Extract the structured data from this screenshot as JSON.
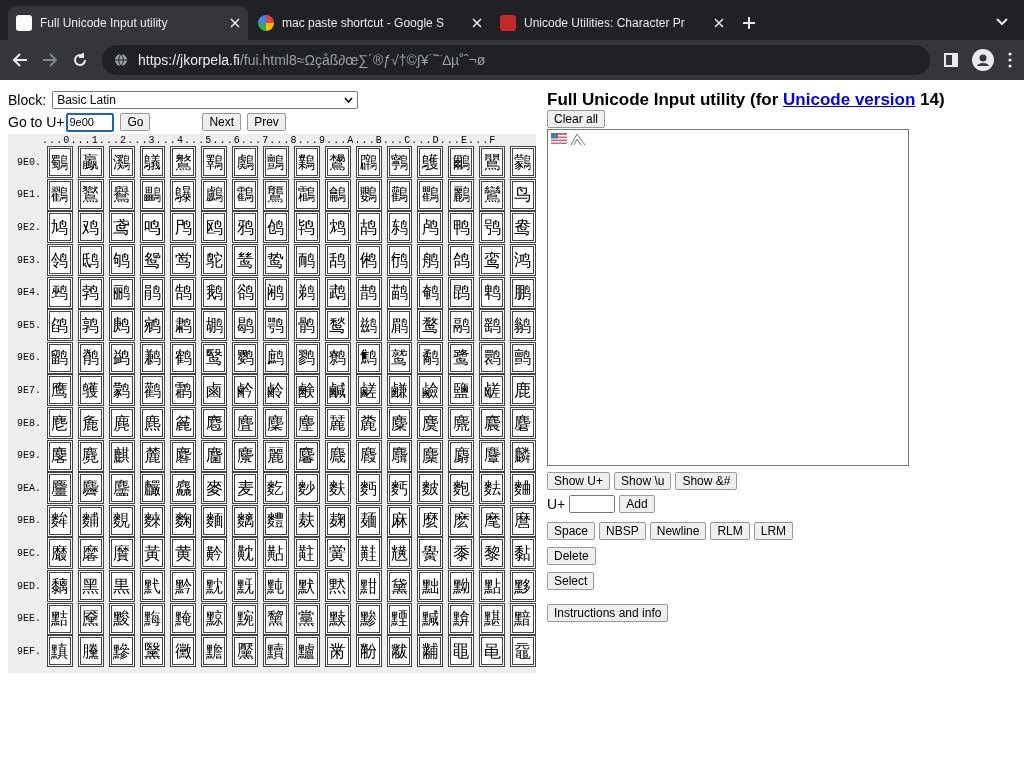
{
  "tabs": [
    {
      "title": "Full Unicode Input utility",
      "selected": true
    },
    {
      "title": "mac paste shortcut - Google S",
      "selected": false
    },
    {
      "title": "Unicode Utilities: Character Pr",
      "selected": false
    }
  ],
  "address": {
    "host": "https://jkorpela.fi",
    "path": "/fui.html8≈Ωçåß∂œ∑´®ƒ√†©∫¥˙˜¨∆µ˚ˆ¬ø"
  },
  "block": {
    "label": "Block:",
    "value": "Basic Latin"
  },
  "goto": {
    "label": "Go to U+",
    "value": "9e00",
    "buttons": [
      "Go",
      "Next",
      "Prev"
    ]
  },
  "grid": {
    "header": "...0...1...2...3...4...5...6...7...8...9...A...B...C...D...E...F",
    "rows": [
      {
        "label": "9E0.",
        "cells": [
          "鸀",
          "鸁",
          "鸂",
          "鸃",
          "鸄",
          "鸅",
          "鸆",
          "鸇",
          "鸈",
          "鸉",
          "鸊",
          "鸋",
          "鸌",
          "鸍",
          "鸎",
          "鸏"
        ]
      },
      {
        "label": "9E1.",
        "cells": [
          "鸐",
          "鸑",
          "鸒",
          "鸓",
          "鸔",
          "鸕",
          "鸖",
          "鸗",
          "鸘",
          "鸙",
          "鸚",
          "鸛",
          "鸜",
          "鸝",
          "鸞",
          "鸟"
        ]
      },
      {
        "label": "9E2.",
        "cells": [
          "鸠",
          "鸡",
          "鸢",
          "鸣",
          "鸤",
          "鸥",
          "鸦",
          "鸧",
          "鸨",
          "鸩",
          "鸪",
          "鸫",
          "鸬",
          "鸭",
          "鸮",
          "鸯"
        ]
      },
      {
        "label": "9E3.",
        "cells": [
          "鸰",
          "鸱",
          "鸲",
          "鸳",
          "鸴",
          "鸵",
          "鸶",
          "鸷",
          "鸸",
          "鸹",
          "鸺",
          "鸻",
          "鸼",
          "鸽",
          "鸾",
          "鸿"
        ]
      },
      {
        "label": "9E4.",
        "cells": [
          "鹀",
          "鹁",
          "鹂",
          "鹃",
          "鹄",
          "鹅",
          "鹆",
          "鹇",
          "鹈",
          "鹉",
          "鹊",
          "鹋",
          "鹌",
          "鹍",
          "鹎",
          "鹏"
        ]
      },
      {
        "label": "9E5.",
        "cells": [
          "鹐",
          "鹑",
          "鹒",
          "鹓",
          "鹔",
          "鹕",
          "鹖",
          "鹗",
          "鹘",
          "鹙",
          "鹚",
          "鹛",
          "鹜",
          "鹝",
          "鹞",
          "鹟"
        ]
      },
      {
        "label": "9E6.",
        "cells": [
          "鹠",
          "鹡",
          "鹢",
          "鹣",
          "鹤",
          "鹥",
          "鹦",
          "鹧",
          "鹨",
          "鹩",
          "鹪",
          "鹫",
          "鹬",
          "鹭",
          "鹮",
          "鹯"
        ]
      },
      {
        "label": "9E7.",
        "cells": [
          "鹰",
          "鹱",
          "鹲",
          "鹳",
          "鹴",
          "鹵",
          "鹶",
          "鹷",
          "鹸",
          "鹹",
          "鹺",
          "鹻",
          "鹼",
          "鹽",
          "鹾",
          "鹿"
        ]
      },
      {
        "label": "9E8.",
        "cells": [
          "麀",
          "麁",
          "麂",
          "麃",
          "麄",
          "麅",
          "麆",
          "麇",
          "麈",
          "麉",
          "麊",
          "麋",
          "麌",
          "麍",
          "麎",
          "麏"
        ]
      },
      {
        "label": "9E9.",
        "cells": [
          "麐",
          "麑",
          "麒",
          "麓",
          "麔",
          "麕",
          "麖",
          "麗",
          "麘",
          "麙",
          "麚",
          "麛",
          "麜",
          "麝",
          "麞",
          "麟"
        ]
      },
      {
        "label": "9EA.",
        "cells": [
          "麠",
          "麡",
          "麢",
          "麣",
          "麤",
          "麥",
          "麦",
          "麧",
          "麨",
          "麩",
          "麪",
          "麫",
          "麬",
          "麭",
          "麮",
          "麯"
        ]
      },
      {
        "label": "9EB.",
        "cells": [
          "麰",
          "麱",
          "麲",
          "麳",
          "麴",
          "麵",
          "麶",
          "麷",
          "麸",
          "麹",
          "麺",
          "麻",
          "麼",
          "麽",
          "麾",
          "麿"
        ]
      },
      {
        "label": "9EC.",
        "cells": [
          "黀",
          "黁",
          "黂",
          "黃",
          "黄",
          "黅",
          "黆",
          "黇",
          "黈",
          "黉",
          "黊",
          "黋",
          "黌",
          "黍",
          "黎",
          "黏"
        ]
      },
      {
        "label": "9ED.",
        "cells": [
          "黐",
          "黑",
          "黒",
          "黓",
          "黔",
          "黕",
          "黖",
          "黗",
          "默",
          "黙",
          "黚",
          "黛",
          "黜",
          "黝",
          "點",
          "黟"
        ]
      },
      {
        "label": "9EE.",
        "cells": [
          "黠",
          "黡",
          "黢",
          "黣",
          "黤",
          "黥",
          "黦",
          "黧",
          "黨",
          "黩",
          "黪",
          "黫",
          "黬",
          "黭",
          "黮",
          "黯"
        ]
      },
      {
        "label": "9EF.",
        "cells": [
          "黰",
          "黱",
          "黲",
          "黳",
          "黴",
          "黵",
          "黶",
          "黷",
          "黸",
          "黹",
          "黺",
          "黻",
          "黼",
          "黽",
          "黾",
          "黿"
        ]
      }
    ]
  },
  "heading": {
    "before": "Full Unicode Input utility (for",
    "link": "Unicode version",
    "after": "14)"
  },
  "clear_button": "Clear all",
  "show_buttons": [
    "Show U+",
    "Show \\u",
    "Show &#"
  ],
  "add": {
    "label": "U+",
    "button": "Add"
  },
  "insert_buttons": [
    "Space",
    "NBSP",
    "Newline",
    "RLM",
    "LRM"
  ],
  "delete_button": "Delete",
  "select_button": "Select",
  "info_button": "Instructions and info"
}
